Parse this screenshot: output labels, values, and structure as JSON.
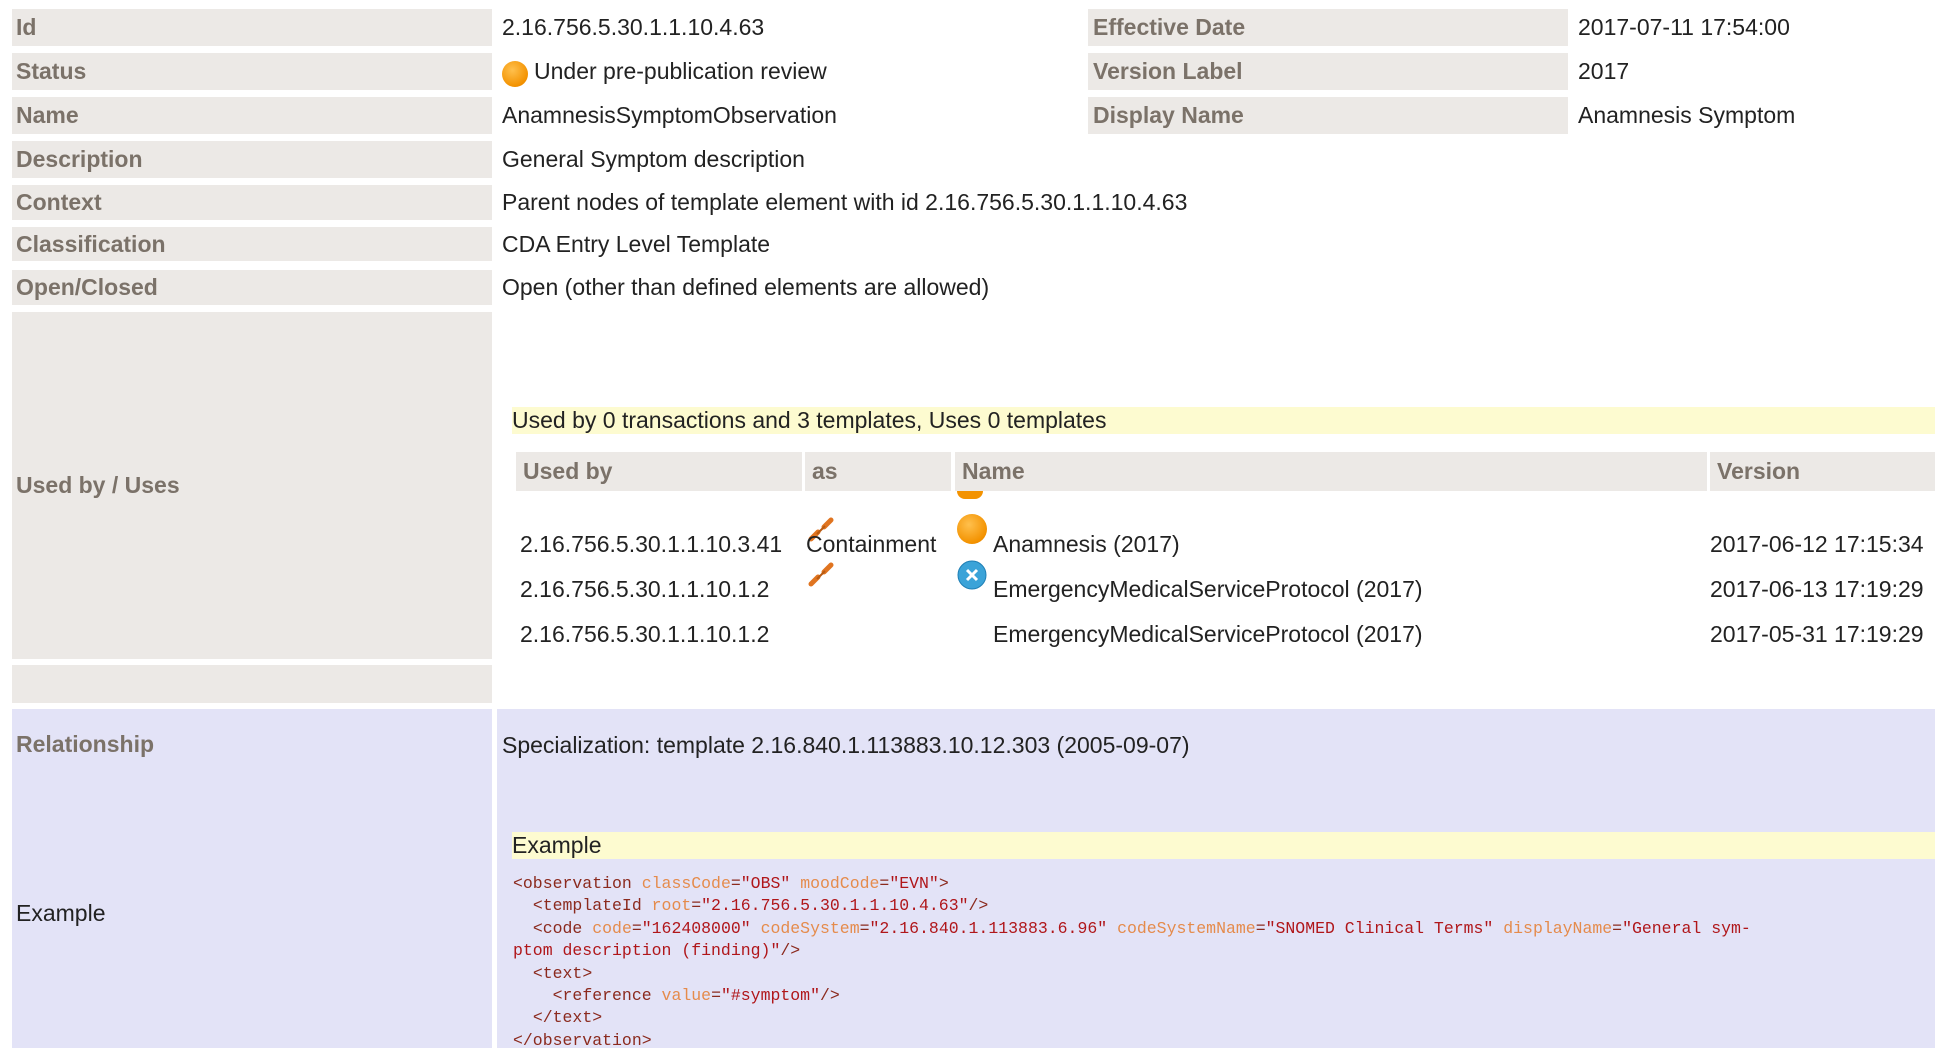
{
  "fields": {
    "id_label": "Id",
    "id_value": "2.16.756.5.30.1.1.10.4.63",
    "effective_date_label": "Effective Date",
    "effective_date_value": "2017-07-11 17:54:00",
    "status_label": "Status",
    "status_value": "Under pre-publication review",
    "version_label_label": "Version Label",
    "version_label_value": "2017",
    "name_label": "Name",
    "name_value": "AnamnesisSymptomObservation",
    "display_name_label": "Display Name",
    "display_name_value": "Anamnesis Symptom",
    "description_label": "Description",
    "description_value": "General Symptom description",
    "context_label": "Context",
    "context_value": "Parent nodes of template element with id 2.16.756.5.30.1.1.10.4.63",
    "classification_label": "Classification",
    "classification_value": "CDA Entry Level Template",
    "open_closed_label": "Open/Closed",
    "open_closed_value": "Open (other than defined elements are allowed)",
    "used_by_label": "Used by / Uses",
    "relationship_label": "Relationship",
    "relationship_value": "Specialization: template 2.16.840.1.113883.10.12.303 (2005-09-07)",
    "example_label": "Example"
  },
  "used_by": {
    "summary": "Used by 0 transactions and 3 templates, Uses 0 templates",
    "columns": [
      "Used by",
      "as",
      "Name",
      "Version"
    ],
    "rows": [
      {
        "used_by": "2.16.756.5.30.1.1.10.3.41",
        "as": "Containment",
        "name": "Anamnesis (2017)",
        "version": "2017-06-12 17:15:34",
        "icon": "status-orange-icon"
      },
      {
        "used_by": "2.16.756.5.30.1.1.10.1.2",
        "as": "",
        "name": "EmergencyMedicalServiceProtocol (2017)",
        "version": "2017-06-13 17:19:29",
        "icon": "status-blue-cancel-icon"
      },
      {
        "used_by": "2.16.756.5.30.1.1.10.1.2",
        "as": "",
        "name": "EmergencyMedicalServiceProtocol (2017)",
        "version": "2017-05-31 17:19:29",
        "icon": ""
      }
    ]
  },
  "example": {
    "title": "Example"
  },
  "colors": {
    "label_bg": "#ece9e6",
    "label_fg": "#7b7269",
    "lavender_bg": "#e3e3f7",
    "header_yellow": "#fdfbd0",
    "status_orange": "#f39200"
  }
}
